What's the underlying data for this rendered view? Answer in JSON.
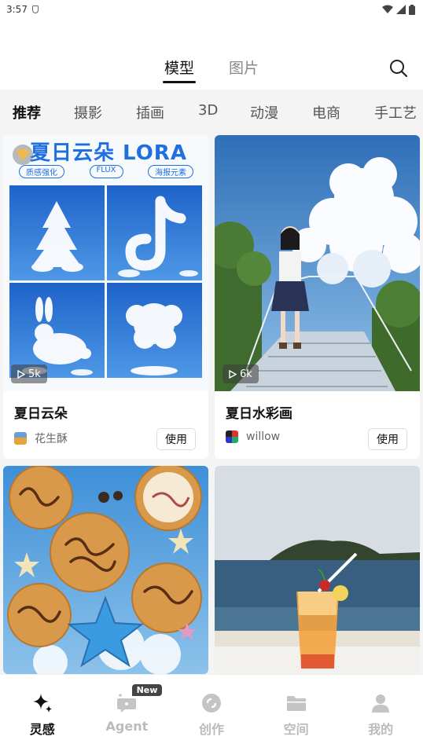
{
  "status_bar": {
    "time": "3:57"
  },
  "main_tabs": [
    {
      "label": "模型",
      "active": true
    },
    {
      "label": "图片",
      "active": false
    }
  ],
  "categories": [
    "推荐",
    "摄影",
    "插画",
    "3D",
    "动漫",
    "电商",
    "手工艺"
  ],
  "cards": [
    {
      "title": "夏日云朵",
      "author": "花生酥",
      "use_label": "使用",
      "play_count": "5k",
      "banner_title": "夏日云朵 LORA",
      "tags": [
        "质感强化",
        "FLUX",
        "海报元素"
      ]
    },
    {
      "title": "夏日水彩画",
      "author": "willow",
      "use_label": "使用",
      "play_count": "6k"
    }
  ],
  "bottom_nav": [
    {
      "label": "灵感",
      "icon": "sparkle-icon",
      "active": true
    },
    {
      "label": "Agent",
      "icon": "agent-icon",
      "active": false,
      "badge": "New"
    },
    {
      "label": "创作",
      "icon": "create-icon",
      "active": false
    },
    {
      "label": "空间",
      "icon": "folder-icon",
      "active": false
    },
    {
      "label": "我的",
      "icon": "person-icon",
      "active": false
    }
  ],
  "colors": {
    "accent": "#111111",
    "inactive": "#bbbbbb",
    "background": "#f4f4f5"
  }
}
